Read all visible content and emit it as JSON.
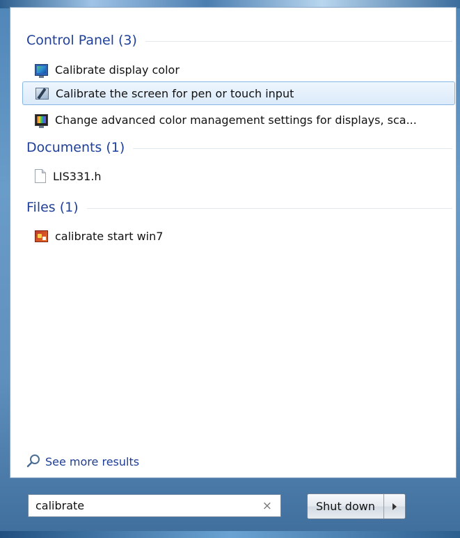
{
  "groups": {
    "control_panel": {
      "title": "Control Panel (3)",
      "items": [
        {
          "label": "Calibrate display color",
          "icon": "display-color-icon"
        },
        {
          "label": "Calibrate the screen for pen or touch input",
          "icon": "pen-touch-icon"
        },
        {
          "label": "Change advanced color management settings for displays, sca...",
          "icon": "color-management-icon"
        }
      ]
    },
    "documents": {
      "title": "Documents (1)",
      "items": [
        {
          "label": "LIS331.h",
          "icon": "document-file-icon"
        }
      ]
    },
    "files": {
      "title": "Files (1)",
      "items": [
        {
          "label": "calibrate start win7",
          "icon": "video-file-icon"
        }
      ]
    }
  },
  "see_more": {
    "label": "See more results",
    "icon": "magnifier-icon"
  },
  "search": {
    "value": "calibrate",
    "clear": "×"
  },
  "shutdown": {
    "label": "Shut down",
    "arrow_icon": "triangle-right-icon"
  },
  "colors": {
    "group_title": "#1e3f9a",
    "link": "#1d3d95",
    "selection": "#dbeafa"
  }
}
